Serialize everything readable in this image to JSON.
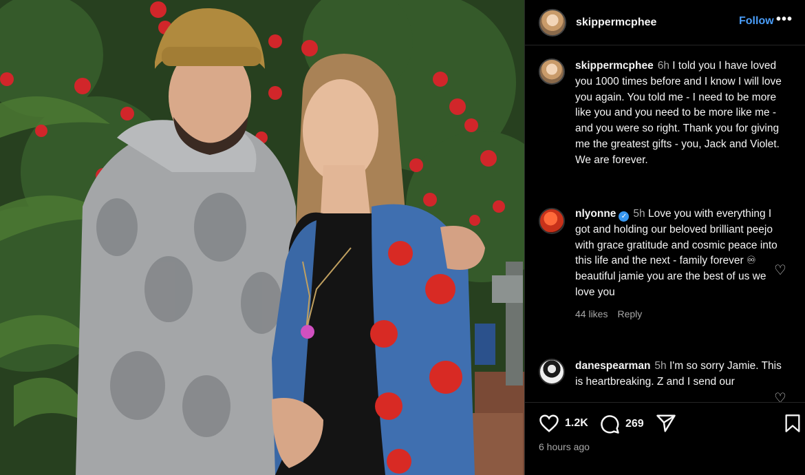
{
  "post": {
    "username": "skippermcphee",
    "follow_label": "Follow",
    "more_label": "•••"
  },
  "comments": [
    {
      "username": "skippermcphee",
      "time": "6h",
      "text": "I told you I have loved you 1000 times before and I know I will love you again. You told me - I need to be more like you and you need to be more like me - and you were so right.  Thank you for giving me the greatest gifts -  you, Jack and Violet. We are forever.",
      "verified": false
    },
    {
      "username": "nlyonne",
      "time": "5h",
      "text": "Love you with everything I got and holding our beloved brilliant peejo with grace gratitude and cosmic peace into this life and the next - family forever ♾ beautiful jamie you are the best of us we love you",
      "verified": true,
      "likes": "44 likes",
      "reply_label": "Reply"
    },
    {
      "username": "danespearman",
      "time": "5h",
      "text": "I'm so sorry Jamie. This is heartbreaking. Z and I send our",
      "verified": false
    }
  ],
  "actions": {
    "likes": "1.2K",
    "comments": "269",
    "posted_ago": "6 hours ago"
  },
  "icons": {
    "like": "heart-icon",
    "comment": "comment-bubble-icon",
    "share": "paper-plane-icon",
    "save": "bookmark-icon",
    "verified": "verified-badge-icon"
  },
  "colors": {
    "background": "#000000",
    "follow": "#4a9df8",
    "muted": "#a8a8a8",
    "verified": "#3897f0"
  }
}
